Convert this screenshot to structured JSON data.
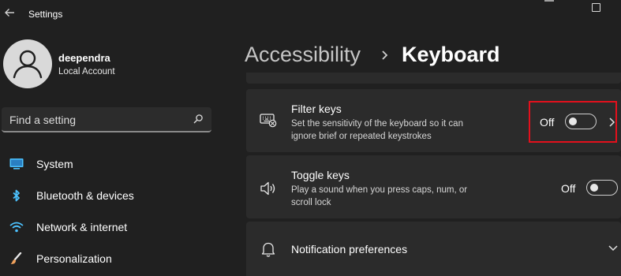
{
  "window": {
    "title": "Settings",
    "back_icon": "back-arrow-icon",
    "minimize_icon": "minimize-icon",
    "maximize_icon": "maximize-icon"
  },
  "user": {
    "name": "deependra",
    "account_type": "Local Account",
    "avatar_icon": "person-icon"
  },
  "search": {
    "placeholder": "Find a setting",
    "icon": "search-icon"
  },
  "sidebar": {
    "items": [
      {
        "label": "System",
        "icon": "monitor-icon",
        "color": "#4cc2ff"
      },
      {
        "label": "Bluetooth & devices",
        "icon": "bluetooth-icon",
        "color": "#4cc2ff"
      },
      {
        "label": "Network & internet",
        "icon": "wifi-icon",
        "color": "#4cc2ff"
      },
      {
        "label": "Personalization",
        "icon": "brush-icon",
        "color": "#f2a25c"
      }
    ]
  },
  "breadcrumb": {
    "parent": "Accessibility",
    "current": "Keyboard"
  },
  "settings": {
    "filter_keys": {
      "title": "Filter keys",
      "description": "Set the sensitivity of the keyboard so it can ignore brief or repeated keystrokes",
      "state_label": "Off",
      "value": false,
      "icon": "keyboard-filter-icon"
    },
    "toggle_keys": {
      "title": "Toggle keys",
      "description": "Play a sound when you press caps, num, or scroll lock",
      "state_label": "Off",
      "value": false,
      "icon": "speaker-icon"
    },
    "notification_preferences": {
      "title": "Notification preferences",
      "icon": "bell-icon"
    }
  },
  "colors": {
    "background": "#202020",
    "card": "#2b2b2b",
    "highlight": "#e3101c",
    "accent": "#4cc2ff"
  }
}
